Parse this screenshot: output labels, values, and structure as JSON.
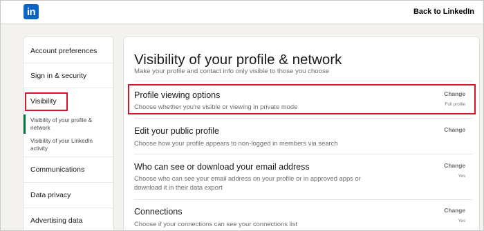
{
  "header": {
    "logo_text": "in",
    "back_link": "Back to LinkedIn"
  },
  "sidebar": {
    "items": [
      {
        "label": "Account preferences"
      },
      {
        "label": "Sign in & security"
      },
      {
        "label": "Visibility"
      },
      {
        "label": "Communications"
      },
      {
        "label": "Data privacy"
      },
      {
        "label": "Advertising data"
      }
    ],
    "sub_items": [
      {
        "label": "Visibility of your profile & network",
        "active": true
      },
      {
        "label": "Visibility of your LinkedIn activity",
        "active": false
      }
    ]
  },
  "main": {
    "title": "Visibility of your profile & network",
    "subtitle": "Make your profile and contact info only visible to those you choose",
    "rows": [
      {
        "title": "Profile viewing options",
        "description": "Choose whether you're visible or viewing in private mode",
        "action": "Change",
        "status": "Full profile"
      },
      {
        "title": "Edit your public profile",
        "description": "Choose how your profile appears to non-logged in members via search",
        "action": "Change",
        "status": ""
      },
      {
        "title": "Who can see or download your email address",
        "description": "Choose who can see your email address on your profile or in approved apps or download it in their data export",
        "action": "Change",
        "status": "Yes"
      },
      {
        "title": "Connections",
        "description": "Choose if your connections can see your connections list",
        "action": "Change",
        "status": "Yes"
      }
    ]
  },
  "colors": {
    "brand": "#0a66c2",
    "highlight": "#d7152a",
    "active_indicator": "#057642"
  }
}
